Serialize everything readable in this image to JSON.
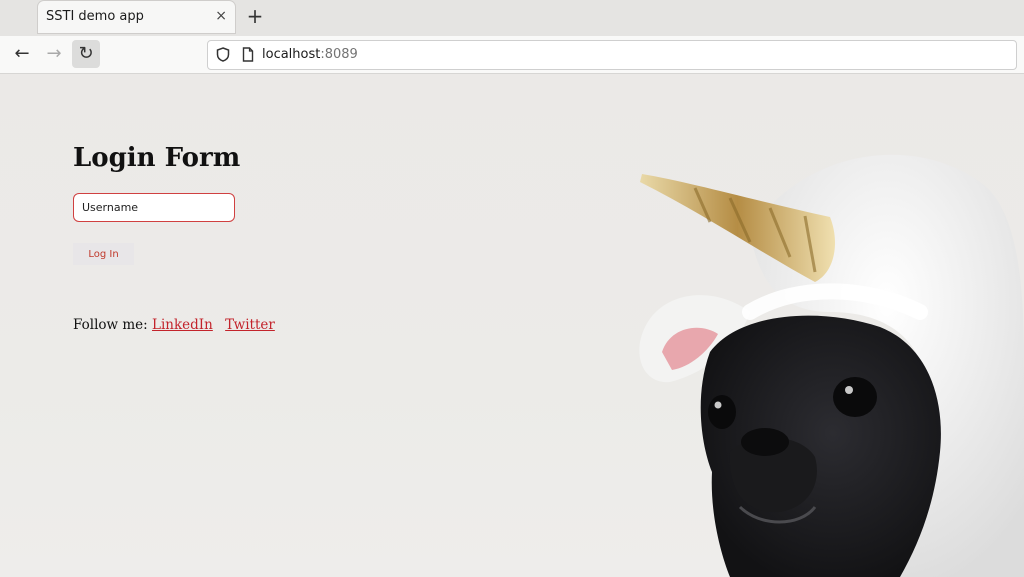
{
  "browser": {
    "tab_title": "SSTI demo app",
    "tab_close": "×",
    "new_tab": "+",
    "back_glyph": "←",
    "forward_glyph": "→",
    "reload_glyph": "↻",
    "url_host": "localhost",
    "url_port": ":8089"
  },
  "page": {
    "title": "Login Form",
    "username_placeholder": "Username",
    "login_button": "Log In",
    "follow_label": "Follow me:",
    "links": [
      "LinkedIn",
      "Twitter"
    ]
  },
  "image": {
    "subject": "pug-in-unicorn-costume",
    "colors": {
      "fur": "#1e1e22",
      "hood": "#f4f4f3",
      "horn": "#c9a85c",
      "ear_inner": "#e8a7ad"
    }
  },
  "colors": {
    "accent": "#c3232b",
    "input_border": "#d04040"
  }
}
